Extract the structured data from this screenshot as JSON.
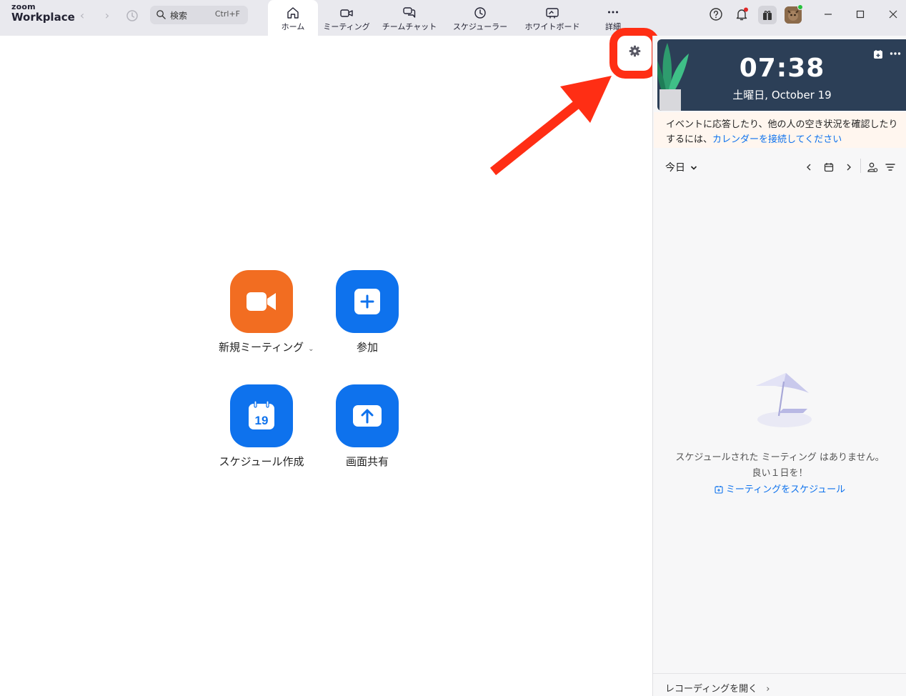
{
  "app": {
    "brand_small": "zoom",
    "brand_name": "Workplace"
  },
  "search": {
    "label": "検索",
    "shortcut": "Ctrl+F"
  },
  "tabs": [
    {
      "label": "ホーム",
      "icon": "home-icon",
      "active": true
    },
    {
      "label": "ミーティング",
      "icon": "video-camera-icon"
    },
    {
      "label": "チームチャット",
      "icon": "chat-bubbles-icon"
    },
    {
      "label": "スケジューラー",
      "icon": "clock-icon"
    },
    {
      "label": "ホワイトボード",
      "icon": "whiteboard-icon"
    },
    {
      "label": "詳細",
      "icon": "more-dots-icon"
    }
  ],
  "actions": {
    "new_meeting": "新規ミーティング",
    "join": "参加",
    "schedule": "スケジュール作成",
    "schedule_day": "19",
    "share_screen": "画面共有"
  },
  "calendar": {
    "time": "07:38",
    "date": "土曜日, October 19",
    "notice_text": "イベントに応答したり、他の人の空き状況を確認したりするには、",
    "notice_link": "カレンダーを接続してください",
    "day_selector": "今日",
    "empty_line1": "スケジュールされた ミーティング はありません。",
    "empty_line2": "良い１日を！",
    "schedule_link": "ミーティングをスケジュール"
  },
  "footer": {
    "recordings": "レコーディングを開く"
  },
  "colors": {
    "accent_blue": "#0e72ed",
    "accent_orange": "#f26d21",
    "highlight_red": "#ff2e14",
    "clock_bg": "#2c3f57"
  }
}
